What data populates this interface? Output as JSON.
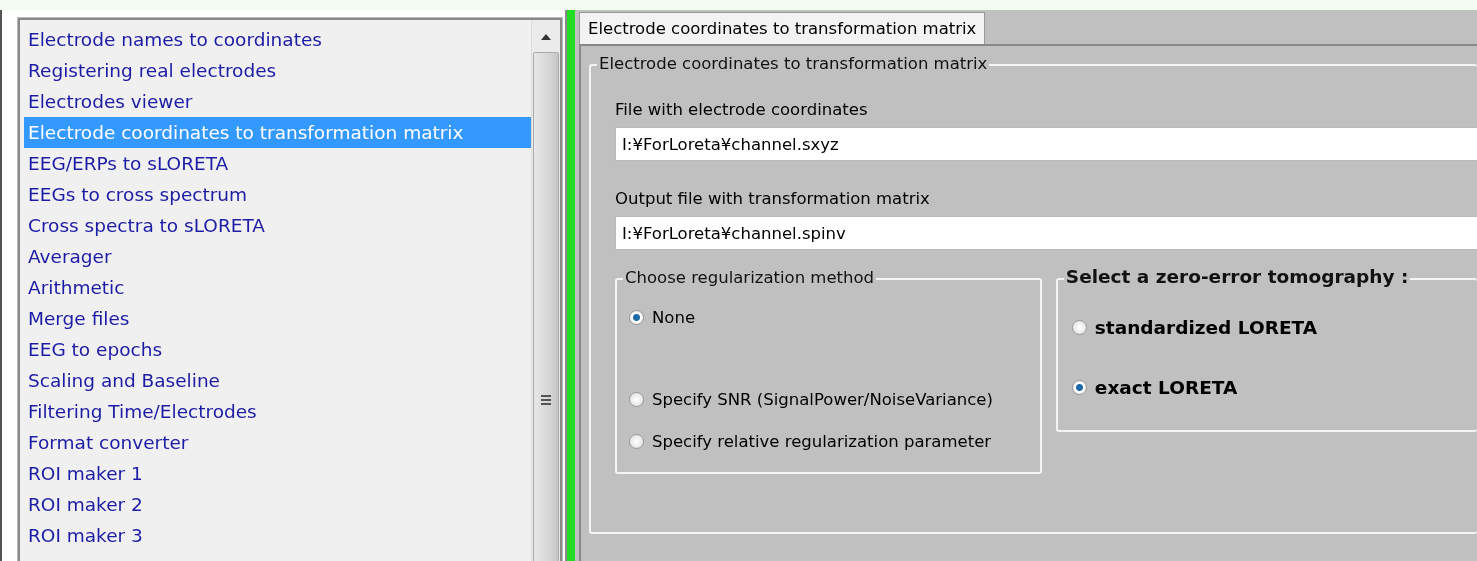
{
  "sidebar": {
    "items": [
      {
        "label": "Electrode names to coordinates",
        "selected": false
      },
      {
        "label": "Registering real electrodes",
        "selected": false
      },
      {
        "label": "Electrodes viewer",
        "selected": false
      },
      {
        "label": "Electrode coordinates to transformation matrix",
        "selected": true
      },
      {
        "label": "EEG/ERPs to sLORETA",
        "selected": false
      },
      {
        "label": "EEGs to cross spectrum",
        "selected": false
      },
      {
        "label": "Cross spectra to sLORETA",
        "selected": false
      },
      {
        "label": "Averager",
        "selected": false
      },
      {
        "label": "Arithmetic",
        "selected": false
      },
      {
        "label": "Merge files",
        "selected": false
      },
      {
        "label": "EEG to epochs",
        "selected": false
      },
      {
        "label": "Scaling and Baseline",
        "selected": false
      },
      {
        "label": "Filtering Time/Electrodes",
        "selected": false
      },
      {
        "label": "Format converter",
        "selected": false
      },
      {
        "label": "ROI maker 1",
        "selected": false
      },
      {
        "label": "ROI maker 2",
        "selected": false
      },
      {
        "label": "ROI maker 3",
        "selected": false
      }
    ]
  },
  "tabs": [
    {
      "label": "Electrode coordinates to transformation matrix",
      "selected": true
    }
  ],
  "panel": {
    "title": "Electrode coordinates to transformation matrix",
    "fields": [
      {
        "label": "File with electrode coordinates",
        "value": "I:¥ForLoreta¥channel.sxyz"
      },
      {
        "label": "Output file with transformation matrix",
        "value": "I:¥ForLoreta¥channel.spinv"
      }
    ],
    "regularization": {
      "title": "Choose regularization method",
      "options": [
        {
          "label": "None",
          "selected": true
        },
        {
          "label": "Specify SNR (SignalPower/NoiseVariance)",
          "selected": false
        },
        {
          "label": "Specify relative regularization parameter",
          "selected": false
        }
      ]
    },
    "tomography": {
      "title": "Select a zero-error tomography :",
      "options": [
        {
          "label": "standardized LORETA",
          "selected": false
        },
        {
          "label": "exact LORETA",
          "selected": true
        }
      ]
    }
  }
}
